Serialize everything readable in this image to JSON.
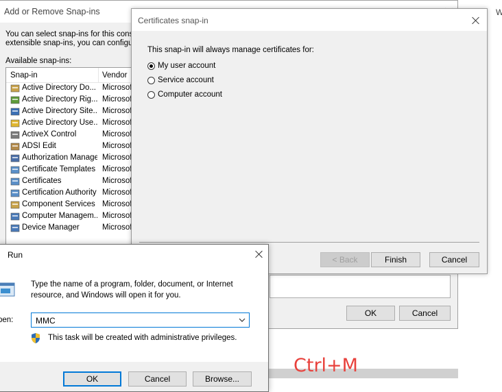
{
  "bg_window": {
    "title": "Add or Remove Snap-ins",
    "intro_line1": "You can select snap-ins for this console",
    "intro_line2": "extensible snap-ins, you can configure",
    "available_label": "Available snap-ins:",
    "columns": {
      "snapin": "Snap-in",
      "vendor": "Vendor"
    },
    "snapins": [
      {
        "name": "Active Directory Do...",
        "vendor": "Microsoft",
        "icon": "directory-icon",
        "color": "#c8a24a"
      },
      {
        "name": "Active Directory Rig...",
        "vendor": "Microsoft",
        "icon": "directory-icon",
        "color": "#5f9b3a"
      },
      {
        "name": "Active Directory Site...",
        "vendor": "Microsoft",
        "icon": "directory-icon",
        "color": "#3a6fb5"
      },
      {
        "name": "Active Directory Use...",
        "vendor": "Microsoft",
        "icon": "directory-icon",
        "color": "#e0b630"
      },
      {
        "name": "ActiveX Control",
        "vendor": "Microsoft",
        "icon": "activex-icon",
        "color": "#7a7a7a"
      },
      {
        "name": "ADSI Edit",
        "vendor": "Microsoft",
        "icon": "edit-icon",
        "color": "#b38a4a"
      },
      {
        "name": "Authorization Manager",
        "vendor": "Microsoft",
        "icon": "authorization-icon",
        "color": "#4a6fa8"
      },
      {
        "name": "Certificate Templates",
        "vendor": "Microsoft",
        "icon": "certificate-icon",
        "color": "#5a8fc8"
      },
      {
        "name": "Certificates",
        "vendor": "Microsoft",
        "icon": "certificate-icon",
        "color": "#5a8fc8"
      },
      {
        "name": "Certification Authority",
        "vendor": "Microsoft",
        "icon": "certificate-icon",
        "color": "#5a8fc8"
      },
      {
        "name": "Component Services",
        "vendor": "Microsoft",
        "icon": "component-icon",
        "color": "#c8a24a"
      },
      {
        "name": "Computer Managem...",
        "vendor": "Microsoft",
        "icon": "computer-icon",
        "color": "#4a7ab8"
      },
      {
        "name": "Device Manager",
        "vendor": "Microsoft",
        "icon": "device-icon",
        "color": "#4a7ab8"
      }
    ],
    "ok_label": "OK",
    "cancel_label": "Cancel",
    "edge_letter": "W"
  },
  "cert_dialog": {
    "title": "Certificates snap-in",
    "prompt": "This snap-in will always manage certificates for:",
    "options": [
      {
        "label": "My user account",
        "selected": true
      },
      {
        "label": "Service account",
        "selected": false
      },
      {
        "label": "Computer account",
        "selected": false
      }
    ],
    "back_label": "< Back",
    "finish_label": "Finish",
    "cancel_label": "Cancel"
  },
  "run_dialog": {
    "title": "Run",
    "description": "Type the name of a program, folder, document, or Internet resource, and Windows will open it for you.",
    "open_label": "pen:",
    "open_value": "MMC",
    "admin_note": "This task will be created with administrative privileges.",
    "ok_label": "OK",
    "cancel_label": "Cancel",
    "browse_label": "Browse..."
  },
  "annotation": {
    "text": "Ctrl+M",
    "color": "#e8413c"
  }
}
